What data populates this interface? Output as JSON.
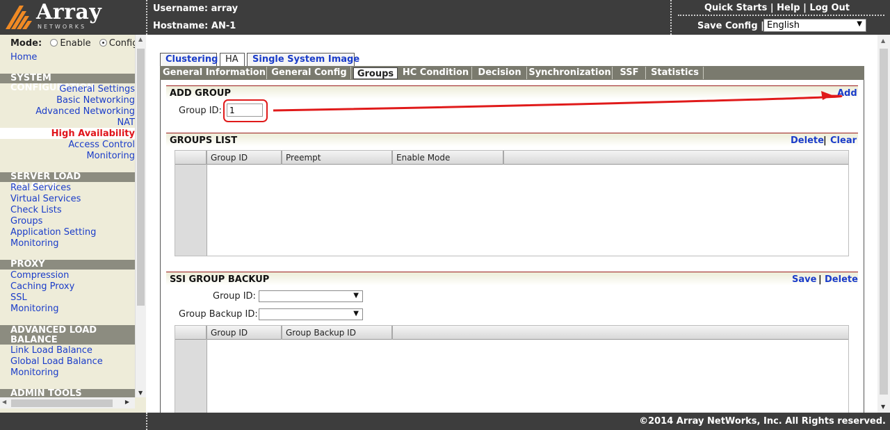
{
  "header": {
    "brand_name": "Array",
    "brand_sub": "NETWORKS",
    "username_label": "Username: array",
    "hostname_label": "Hostname: AN-1",
    "links": [
      "Quick Starts",
      "Help",
      "Log Out"
    ],
    "link_separator": "|",
    "save_config_label": "Save Config |",
    "language_selected": "English",
    "brand_color": "#f08a24"
  },
  "sidebar": {
    "mode_label": "Mode:",
    "mode_options": [
      "Enable",
      "Config"
    ],
    "mode_selected": "Config",
    "home": "Home",
    "system_configuration": {
      "title": "SYSTEM CONFIGURATION",
      "items": [
        "General Settings",
        "Basic Networking",
        "Advanced Networking",
        "NAT",
        "High Availability",
        "Access Control",
        "Monitoring"
      ],
      "active": "High Availability"
    },
    "server_load_balance": {
      "title": "SERVER LOAD BALANCE",
      "items": [
        "Real Services",
        "Virtual Services",
        "Check Lists",
        "Groups",
        "Application Setting",
        "Monitoring"
      ]
    },
    "proxy": {
      "title": "PROXY",
      "items": [
        "Compression",
        "Caching Proxy",
        "SSL",
        "Monitoring"
      ]
    },
    "advanced_load_balance": {
      "title_line1": "ADVANCED LOAD",
      "title_line2": "BALANCE",
      "items": [
        "Link Load Balance",
        "Global Load Balance",
        "Monitoring"
      ]
    },
    "admin_tools": {
      "title": "ADMIN TOOLS"
    }
  },
  "tabs_top": [
    "Clustering",
    "HA",
    "Single System Image"
  ],
  "tabs_top_selected": "HA",
  "tabs_sub": [
    "General Information",
    "General Config",
    "Groups",
    "HC Condition",
    "Decision",
    "Synchronization",
    "SSF",
    "Statistics"
  ],
  "tabs_sub_selected": "Groups",
  "add_group": {
    "title": "ADD GROUP",
    "action": "Add",
    "group_id_label": "Group ID:",
    "group_id_value": "1"
  },
  "groups_list": {
    "title": "GROUPS LIST",
    "actions": [
      "Delete",
      "Clear"
    ],
    "columns": [
      "Group ID",
      "Preempt",
      "Enable Mode"
    ],
    "rows": []
  },
  "ssi_group_backup": {
    "title": "SSI GROUP BACKUP",
    "actions": [
      "Save",
      "Delete"
    ],
    "group_id_label": "Group ID:",
    "group_id_value": "",
    "group_backup_id_label": "Group Backup ID:",
    "group_backup_id_value": "",
    "columns": [
      "Group ID",
      "Group Backup ID"
    ],
    "rows": []
  },
  "footer": {
    "copyright": "©2014 Array NetWorks, Inc. All Rights reserved."
  },
  "colors": {
    "header_bg": "#3d3d3d",
    "sidebar_bg": "#eeecd9",
    "section_head_bg": "#8c8c80",
    "link_blue": "#1a3cc9",
    "active_red": "#e0141b",
    "annotation_red": "#e01a1a"
  }
}
